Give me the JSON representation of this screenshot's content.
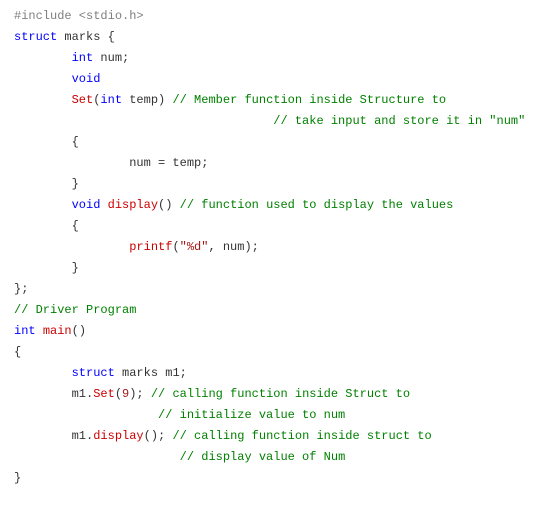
{
  "code": {
    "l1_pp": "#include",
    "l1_inc": " <stdio.h>",
    "l2_kw1": "struct",
    "l2_id": " marks ",
    "l2_br": "{",
    "l3_kw": "int",
    "l3_rest": " num;",
    "l4_kw": "void",
    "l5_fn": "Set",
    "l5_p1": "(",
    "l5_kw": "int",
    "l5_rest": " temp) ",
    "l5_cm": "// Member function inside Structure to",
    "l6_cm": "// take input and store it in \"num\"",
    "l7": "{",
    "l8_a": "num ",
    "l8_op": "=",
    "l8_b": " temp;",
    "l9": "}",
    "l10_kw": "void",
    "l10_sp": " ",
    "l10_fn": "display",
    "l10_rest": "() ",
    "l10_cm": "// function used to display the values",
    "l11": "{",
    "l12_fn": "printf",
    "l12_p1": "(",
    "l12_str": "\"%d\"",
    "l12_mid": ", num);",
    "l13": "}",
    "l14": "};",
    "l15_cm": "// Driver Program",
    "l16_kw": "int",
    "l16_sp": " ",
    "l16_fn": "main",
    "l16_rest": "()",
    "l17": "{",
    "l18_kw": "struct",
    "l18_rest": " marks m1;",
    "l19_a": "m1.",
    "l19_fn": "Set",
    "l19_p1": "(",
    "l19_num": "9",
    "l19_p2": "); ",
    "l19_cm": "// calling function inside Struct to",
    "l20_cm": "// initialize value to num",
    "l21_a": "m1.",
    "l21_fn": "display",
    "l21_rest": "(); ",
    "l21_cm": "// calling function inside struct to",
    "l22_cm": "// display value of Num",
    "l23": "}"
  }
}
